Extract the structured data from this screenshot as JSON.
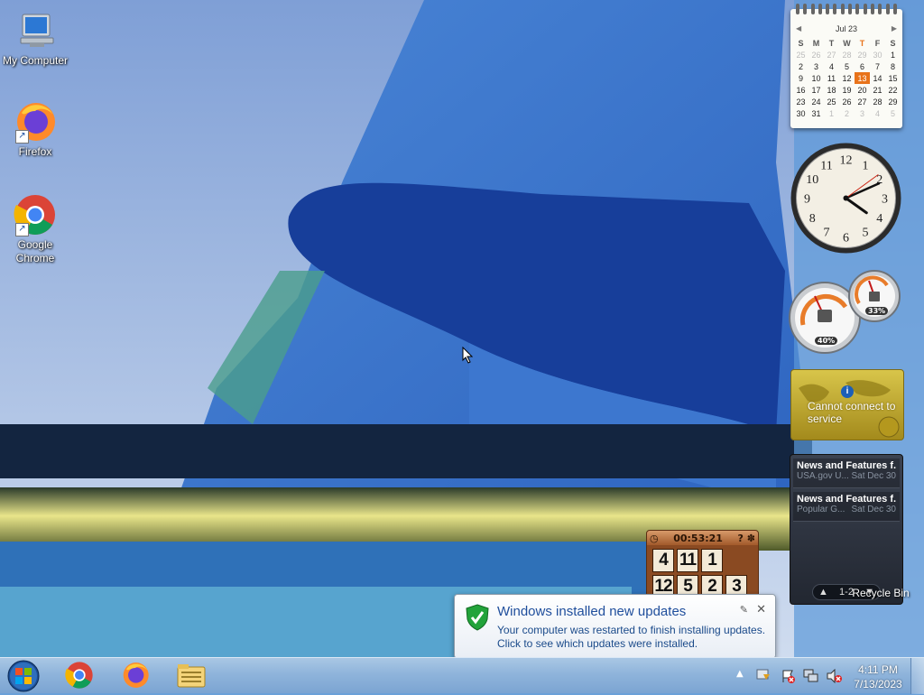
{
  "desktop": {
    "icons": [
      {
        "label": "My Computer",
        "icon": "computer-icon"
      },
      {
        "label": "Firefox",
        "icon": "firefox-icon"
      },
      {
        "label": "Google Chrome",
        "icon": "chrome-icon"
      }
    ],
    "recycle_bin_label": "Recycle Bin"
  },
  "calendar": {
    "month_label": "Jul 23",
    "weekdays": [
      "S",
      "M",
      "T",
      "W",
      "T",
      "F",
      "S"
    ],
    "weeks": [
      [
        "25",
        "26",
        "27",
        "28",
        "29",
        "30",
        "1"
      ],
      [
        "2",
        "3",
        "4",
        "5",
        "6",
        "7",
        "8"
      ],
      [
        "9",
        "10",
        "11",
        "12",
        "13",
        "14",
        "15"
      ],
      [
        "16",
        "17",
        "18",
        "19",
        "20",
        "21",
        "22"
      ],
      [
        "23",
        "24",
        "25",
        "26",
        "27",
        "28",
        "29"
      ],
      [
        "30",
        "31",
        "1",
        "2",
        "3",
        "4",
        "5"
      ]
    ],
    "today": "13"
  },
  "clock": {
    "hour": 4,
    "minute": 11,
    "second": 9,
    "numerals": [
      "12",
      "1",
      "2",
      "3",
      "4",
      "5",
      "6",
      "7",
      "8",
      "9",
      "10",
      "11"
    ]
  },
  "cpu_meter": {
    "cpu_percent": "40%",
    "memory_percent": "33%"
  },
  "weather": {
    "message": "Cannot connect to service"
  },
  "feed": {
    "items": [
      {
        "title": "News and Features f...",
        "source": "USA.gov U...",
        "date": "Sat Dec 30"
      },
      {
        "title": "News and Features f...",
        "source": "Popular G...",
        "date": "Sat Dec 30"
      }
    ],
    "pager": "1-2"
  },
  "puzzle": {
    "timer": "00:53:21",
    "tiles": [
      "4",
      "11",
      "1",
      "",
      "12",
      "5",
      "2",
      "3"
    ]
  },
  "notification": {
    "title": "Windows installed new updates",
    "line1": "Your computer was restarted to finish installing updates.",
    "line2": "Click to see which updates were installed."
  },
  "taskbar": {
    "pinned": [
      "chrome-icon",
      "firefox-icon",
      "explorer-icon"
    ],
    "time": "4:11 PM",
    "date": "7/13/2023"
  },
  "colors": {
    "taskbar": "#8fb4db",
    "today": "#e8731a",
    "accent": "#1f4e9c"
  }
}
